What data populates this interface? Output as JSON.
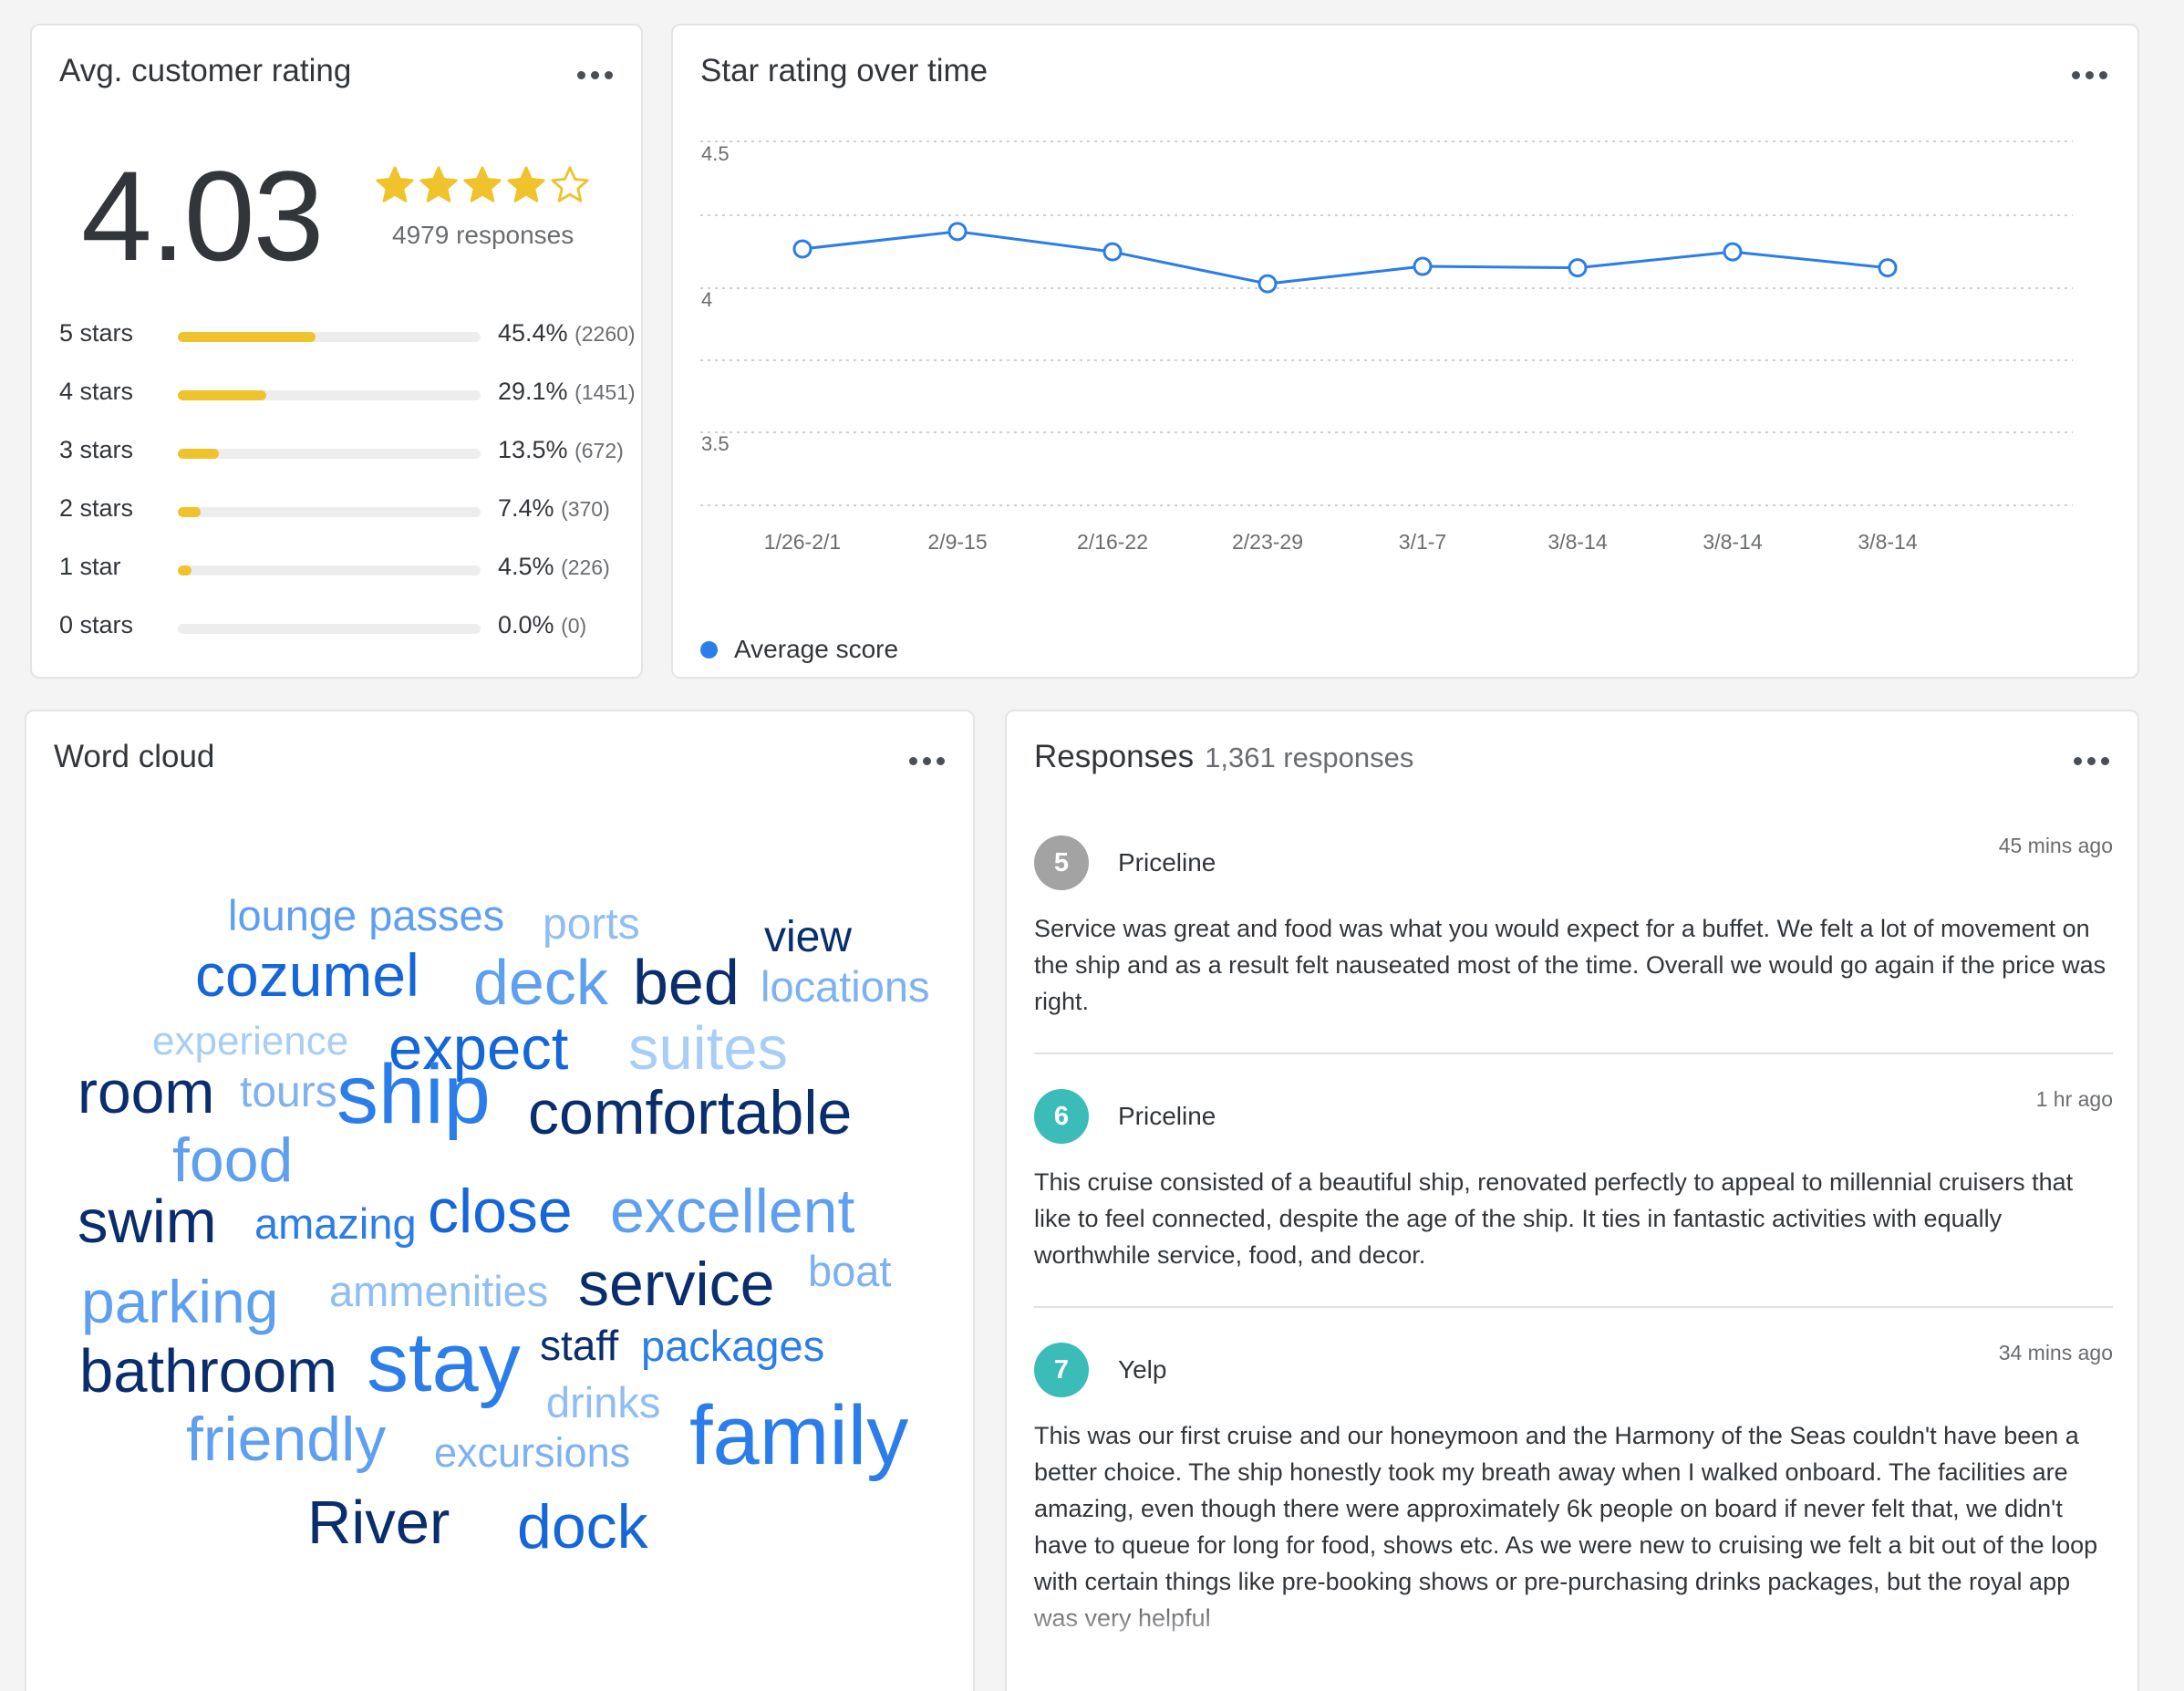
{
  "rating_card": {
    "title": "Avg. customer rating",
    "score": "4.03",
    "stars_value": 4.03,
    "stars_max": 5,
    "responses_label": "4979 responses",
    "star_color": "#f0c32c",
    "distribution": [
      {
        "label": "5 stars",
        "pct": "45.4%",
        "count": "(2260)",
        "fraction": 0.454
      },
      {
        "label": "4 stars",
        "pct": "29.1%",
        "count": "(1451)",
        "fraction": 0.291
      },
      {
        "label": "3 stars",
        "pct": "13.5%",
        "count": "(672)",
        "fraction": 0.135
      },
      {
        "label": "2 stars",
        "pct": "7.4%",
        "count": "(370)",
        "fraction": 0.074
      },
      {
        "label": "1 star",
        "pct": "4.5%",
        "count": "(226)",
        "fraction": 0.045
      },
      {
        "label": "0 stars",
        "pct": "0.0%",
        "count": "(0)",
        "fraction": 0.0
      }
    ]
  },
  "line_card": {
    "title": "Star rating over time",
    "legend": "Average score",
    "color": "#2b7de9"
  },
  "chart_data": {
    "type": "line",
    "title": "Star rating over time",
    "categories": [
      "1/26-2/1",
      "2/9-15",
      "2/16-22",
      "2/23-29",
      "3/1-7",
      "3/8-14",
      "3/8-14",
      "3/8-14"
    ],
    "series": [
      {
        "name": "Average score",
        "values": [
          4.17,
          4.23,
          4.16,
          4.05,
          4.11,
          4.105,
          4.16,
          4.105
        ]
      }
    ],
    "yticks": [
      "4.5",
      "4",
      "3.5"
    ],
    "ylim": [
      3.35,
      4.55
    ],
    "grid": true,
    "legend_position": "bottom-left"
  },
  "cloud_card": {
    "title": "Word cloud",
    "words": [
      {
        "text": "lounge passes",
        "color": "#5e9ff0"
      },
      {
        "text": "ports",
        "color": "#90bdf3"
      },
      {
        "text": "view",
        "color": "#0a2d6e"
      },
      {
        "text": "cozumel",
        "color": "#1466d9"
      },
      {
        "text": "deck",
        "color": "#5e9ff0"
      },
      {
        "text": "bed",
        "color": "#0a2d6e"
      },
      {
        "text": "locations",
        "color": "#7eb1f1"
      },
      {
        "text": "experience",
        "color": "#a8cdf6"
      },
      {
        "text": "expect",
        "color": "#1466d9"
      },
      {
        "text": "suites",
        "color": "#a8cdf6"
      },
      {
        "text": "room",
        "color": "#0a2d6e"
      },
      {
        "text": "tours",
        "color": "#7eb1f1"
      },
      {
        "text": "ship",
        "color": "#2b7de9"
      },
      {
        "text": "comfortable",
        "color": "#0a2d6e"
      },
      {
        "text": "food",
        "color": "#5e9ff0"
      },
      {
        "text": "swim",
        "color": "#0a2d6e"
      },
      {
        "text": "amazing",
        "color": "#2b7de9"
      },
      {
        "text": "close",
        "color": "#1466d9"
      },
      {
        "text": "excellent",
        "color": "#5e9ff0"
      },
      {
        "text": "parking",
        "color": "#5e9ff0"
      },
      {
        "text": "ammenities",
        "color": "#90bdf3"
      },
      {
        "text": "service",
        "color": "#0a2d6e"
      },
      {
        "text": "boat",
        "color": "#7eb1f1"
      },
      {
        "text": "bathroom",
        "color": "#0a2d6e"
      },
      {
        "text": "stay",
        "color": "#2b7de9"
      },
      {
        "text": "staff",
        "color": "#0a2d6e"
      },
      {
        "text": "packages",
        "color": "#2b7de9"
      },
      {
        "text": "drinks",
        "color": "#90bdf3"
      },
      {
        "text": "friendly",
        "color": "#5e9ff0"
      },
      {
        "text": "excursions",
        "color": "#7eb1f1"
      },
      {
        "text": "family",
        "color": "#2b7de9"
      },
      {
        "text": "River",
        "color": "#0a2d6e"
      },
      {
        "text": "dock",
        "color": "#1466d9"
      }
    ]
  },
  "responses_card": {
    "title": "Responses",
    "count_label": "1,361 responses",
    "items": [
      {
        "score": "5",
        "badge_color": "#a3a3a3",
        "source": "Priceline",
        "time": "45 mins ago",
        "text": "Service was great and food was what you would expect for a buffet. We felt a lot of movement on the ship and as a result felt nauseated most of the time. Overall we would go again if the price was right."
      },
      {
        "score": "6",
        "badge_color": "#3bbcb9",
        "source": "Priceline",
        "time": "1 hr ago",
        "text": "This cruise consisted of a beautiful ship, renovated perfectly to appeal to millennial cruisers that like to feel connected, despite the age of the ship. It ties in fantastic activities with equally worthwhile service, food, and decor."
      },
      {
        "score": "7",
        "badge_color": "#3bbcb9",
        "source": "Yelp",
        "time": "34 mins ago",
        "text": "This was our first cruise and our honeymoon and the Harmony of the Seas couldn't have been a better choice. The ship honestly took my breath away when I walked onboard. The facilities are amazing, even though there were approximately 6k people on board if never felt that, we didn't have to queue for long for food, shows etc. As we were new to cruising we felt a bit out of the loop with certain things like pre-booking shows or pre-purchasing drinks packages, but the royal app was very helpful"
      }
    ]
  }
}
